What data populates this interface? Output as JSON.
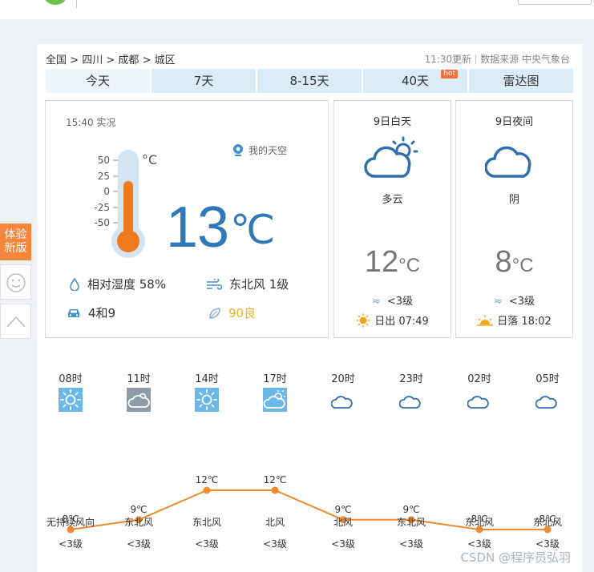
{
  "breadcrumb": [
    "全国",
    "四川",
    "成都",
    "城区"
  ],
  "breadcrumb_sep": ">",
  "source": {
    "updated": "11:30更新",
    "provider": "数据来源 中央气象台"
  },
  "tabs": [
    {
      "label": "今天",
      "active": true
    },
    {
      "label": "7天"
    },
    {
      "label": "8-15天"
    },
    {
      "label": "40天",
      "badge": "hot"
    },
    {
      "label": "雷达图"
    }
  ],
  "side": {
    "new_version": "体验新版"
  },
  "now": {
    "time": "15:40 实况",
    "my_sky": "我的天空",
    "temp": "13",
    "unit": "℃",
    "thermo_unit": "°C",
    "thermo_scale": [
      "50",
      "25",
      "0",
      "-25",
      "-50"
    ],
    "humidity": "相对湿度  58%",
    "wind": "东北风  1级",
    "traffic": "4和9",
    "aqi": "90良"
  },
  "day_forecast": [
    {
      "title": "9日白天",
      "icon": "partly-cloudy-day-icon",
      "cond": "多云",
      "temp": "12",
      "unit": "°C",
      "wind": "<3级",
      "sun": "日出 07:49"
    },
    {
      "title": "9日夜间",
      "icon": "cloudy-night-icon",
      "cond": "阴",
      "temp": "8",
      "unit": "°C",
      "wind": "<3级",
      "sun": "日落 18:02"
    }
  ],
  "chart_data": {
    "type": "line",
    "categories": [
      "08时",
      "11时",
      "14时",
      "17时",
      "20时",
      "23时",
      "02时",
      "05时"
    ],
    "values": [
      8,
      9,
      12,
      12,
      9,
      9,
      8,
      8
    ],
    "labels": [
      "8℃",
      "9℃",
      "12℃",
      "12℃",
      "9℃",
      "9℃",
      "8℃",
      "8℃"
    ],
    "icons": [
      "sunny-icon",
      "cloudy-icon",
      "sunny-icon",
      "partly-cloudy-icon",
      "moon-cloud-icon",
      "moon-cloud-icon",
      "moon-cloud-icon",
      "moon-cloud-icon"
    ],
    "wind": [
      "无持续风向",
      "东北风",
      "东北风",
      "北风",
      "北风",
      "东北风",
      "东北风",
      "东北风"
    ],
    "wind_level": [
      "<3级",
      "<3级",
      "<3级",
      "<3级",
      "<3级",
      "<3级",
      "<3级",
      "<3级"
    ],
    "ylim": [
      8,
      12
    ],
    "line_color": "#f08a2e"
  },
  "watermark": "CSDN @程序员弘羽",
  "colors": {
    "accent": "#2f79b9",
    "orange": "#f5863b",
    "tab_bg": "#dbecf9"
  }
}
